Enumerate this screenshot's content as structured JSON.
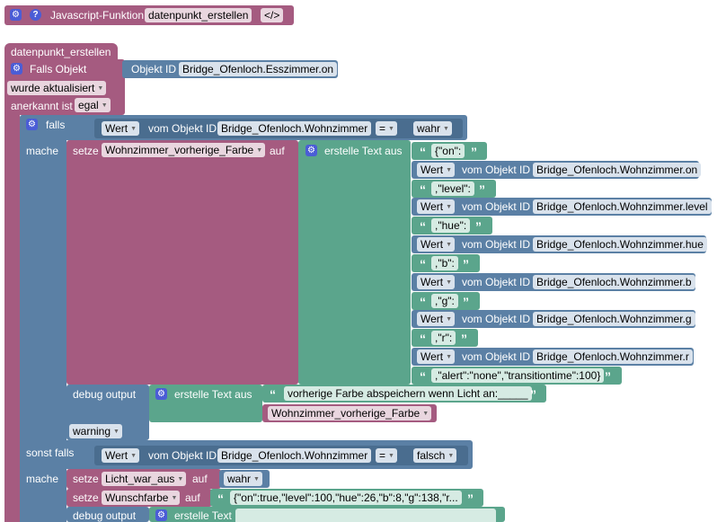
{
  "header": {
    "title": "Javascript-Funktion",
    "function_name": "datenpunkt_erstellen",
    "code_label": "</>"
  },
  "func_block": {
    "name": "datenpunkt_erstellen"
  },
  "trigger": {
    "label": "Falls Objekt",
    "object_label": "Objekt ID",
    "object_id": "Bridge_Ofenloch.Esszimmer.on",
    "event_option": "wurde aktualisiert",
    "ack_label": "anerkannt ist",
    "ack_option": "egal"
  },
  "if_block": {
    "falls": "falls",
    "mache": "mache",
    "sonst_falls": "sonst falls",
    "cond1": {
      "wert": "Wert",
      "vom": "vom Objekt ID",
      "id": "Bridge_Ofenloch.Wohnzimmer",
      "op": "=",
      "value": "wahr"
    },
    "cond2": {
      "wert": "Wert",
      "vom": "vom Objekt ID",
      "id": "Bridge_Ofenloch.Wohnzimmer",
      "op": "=",
      "value": "falsch"
    }
  },
  "set1": {
    "setze": "setze",
    "var": "Wohnzimmer_vorherige_Farbe",
    "auf": "auf",
    "text_label": "erstelle Text aus",
    "items": [
      {
        "type": "str",
        "text": "{\"on\":"
      },
      {
        "type": "val",
        "wert": "Wert",
        "vom": "vom Objekt ID",
        "id": "Bridge_Ofenloch.Wohnzimmer.on"
      },
      {
        "type": "str",
        "text": ",\"level\":"
      },
      {
        "type": "val",
        "wert": "Wert",
        "vom": "vom Objekt ID",
        "id": "Bridge_Ofenloch.Wohnzimmer.level"
      },
      {
        "type": "str",
        "text": ",\"hue\":"
      },
      {
        "type": "val",
        "wert": "Wert",
        "vom": "vom Objekt ID",
        "id": "Bridge_Ofenloch.Wohnzimmer.hue"
      },
      {
        "type": "str",
        "text": ",\"b\":"
      },
      {
        "type": "val",
        "wert": "Wert",
        "vom": "vom Objekt ID",
        "id": "Bridge_Ofenloch.Wohnzimmer.b"
      },
      {
        "type": "str",
        "text": ",\"g\":"
      },
      {
        "type": "val",
        "wert": "Wert",
        "vom": "vom Objekt ID",
        "id": "Bridge_Ofenloch.Wohnzimmer.g"
      },
      {
        "type": "str",
        "text": ",\"r\":"
      },
      {
        "type": "val",
        "wert": "Wert",
        "vom": "vom Objekt ID",
        "id": "Bridge_Ofenloch.Wohnzimmer.r"
      },
      {
        "type": "str",
        "text": ",\"alert\":\"none\",\"transitiontime\":100}"
      }
    ]
  },
  "debug1": {
    "label": "debug output",
    "text_label": "erstelle Text aus",
    "str": "vorherige Farbe abspeichern wenn Licht an:_____",
    "var": "Wohnzimmer_vorherige_Farbe",
    "level": "warning"
  },
  "set2": {
    "setze": "setze",
    "var": "Licht_war_aus",
    "auf": "auf",
    "value": "wahr"
  },
  "set3": {
    "setze": "setze",
    "var": "Wunschfarbe",
    "auf": "auf",
    "str": "{\"on\":true,\"level\":100,\"hue\":26,\"b\":8,\"g\":138,\"r..."
  },
  "debug2": {
    "label": "debug output",
    "text_label": "erstelle Text"
  },
  "colors": {
    "procedure": "#a55b80",
    "logic": "#5b80a5",
    "text": "#5ba58c",
    "gear": "#4b5dd6"
  }
}
